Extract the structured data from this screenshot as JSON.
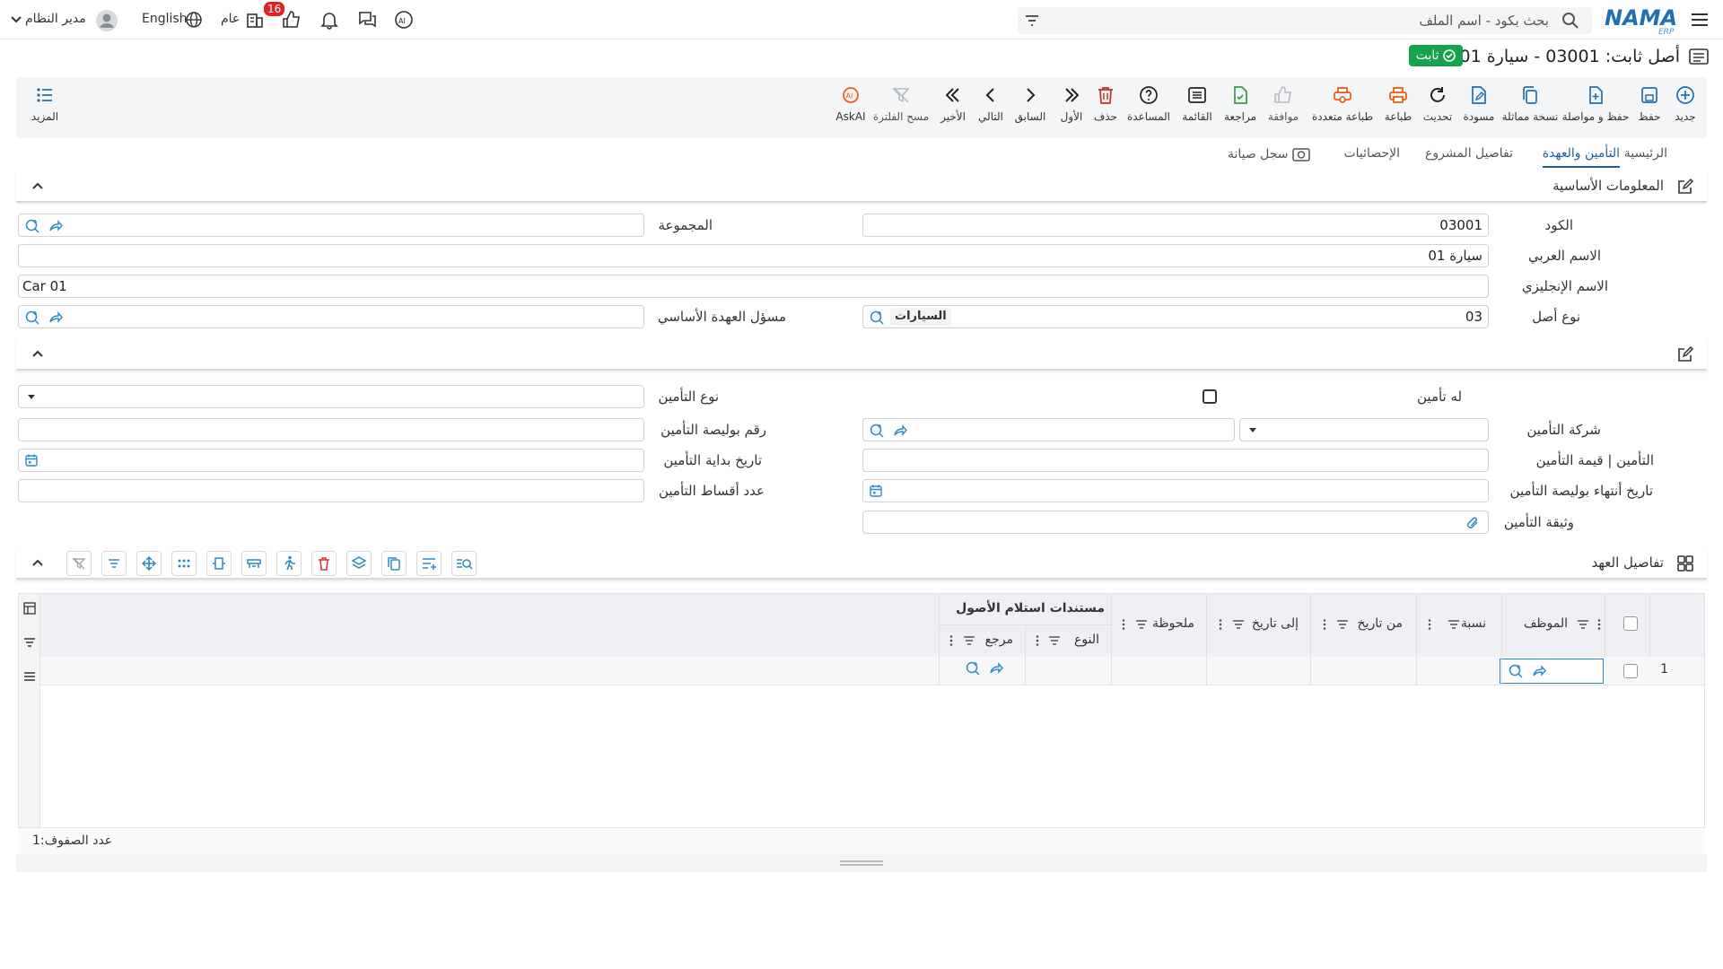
{
  "topbar": {
    "search_placeholder": "بحث بكود - اسم الملف",
    "notifications_count": "16",
    "general_label": "عام",
    "language_label": "English",
    "user_label": "مدير النظام"
  },
  "page": {
    "title": "أصل ثابت: 03001 - سيارة 01",
    "status": "ثابت"
  },
  "toolbar": {
    "new": "جديد",
    "save": "حفظ",
    "save_continue": "حفظ و مواصلة",
    "duplicate": "نسخة مماثلة",
    "draft": "مسودة",
    "refresh": "تحديث",
    "print": "طباعة",
    "multi_print": "طباعة متعددة",
    "approve": "موافقة",
    "review": "مراجعة",
    "list": "القائمة",
    "help": "المساعدة",
    "delete": "حذف",
    "first": "الأول",
    "previous": "السابق",
    "next": "التالي",
    "last": "الأخير",
    "clear_filter": "مسح الفلترة",
    "askai": "AskAI",
    "more": "المزيد"
  },
  "tabs": [
    "الرئيسية",
    "التأمين والعهدة",
    "تفاصيل المشروع",
    "الإحصائيات",
    "سجل صيانة"
  ],
  "basic_info": {
    "title": "المعلومات الأساسية",
    "code_label": "الكود",
    "code_value": "03001",
    "group_label": "المجموعة",
    "arabic_name_label": "الاسم العربي",
    "arabic_name_value": "سيارة 01",
    "english_name_label": "الاسم الإنجليزي",
    "english_name_value": "Car 01",
    "asset_type_label": "نوع أصل",
    "asset_type_code": "03",
    "asset_type_name": "السيارات",
    "custody_owner_label": "مسؤل العهدة الأساسي"
  },
  "insurance": {
    "has_insurance_label": "له تأمين",
    "insurance_type_label": "نوع التأمين",
    "company_label": "شركة التأمين",
    "policy_no_label": "رقم بوليصة التأمين",
    "value_label": "التأمين | قيمة التأمين",
    "start_date_label": "تاريخ بداية التأمين",
    "end_date_label": "تاريخ أنتهاء بوليصة التأمين",
    "installments_label": "عدد أقساط التأمين",
    "document_label": "وثيقة التأمين"
  },
  "custody": {
    "title": "تفاصيل العهد",
    "columns": {
      "employee": "الموظف",
      "ratio": "نسبة",
      "from_date": "من تاريخ",
      "to_date": "إلى تاريخ",
      "note": "ملحوظة",
      "docs_group": "مستندات استلام الأصول",
      "type": "النوع",
      "reference": "مرجع"
    },
    "row_number": "1",
    "rows_count_label": "عدد الصفوف:",
    "rows_count": "1"
  }
}
